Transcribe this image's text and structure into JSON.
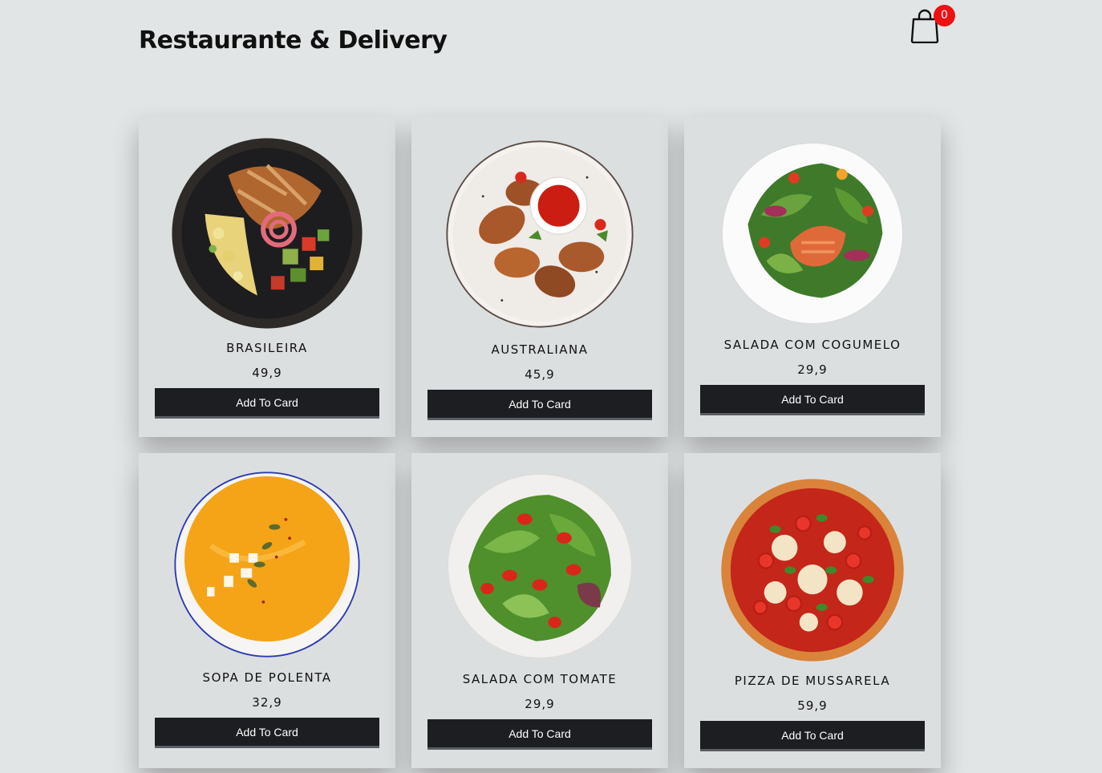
{
  "header": {
    "title": "Restaurante & Delivery"
  },
  "cart": {
    "icon": "shopping-bag-icon",
    "count": "0",
    "badge_color": "#ee1111"
  },
  "products": [
    {
      "name": "BRASILEIRA",
      "price": "49,9",
      "button_label": "Add To Card"
    },
    {
      "name": "AUSTRALIANA",
      "price": "45,9",
      "button_label": "Add To Card"
    },
    {
      "name": "SALADA COM COGUMELO",
      "price": "29,9",
      "button_label": "Add To Card"
    },
    {
      "name": "SOPA DE POLENTA",
      "price": "32,9",
      "button_label": "Add To Card"
    },
    {
      "name": "SALADA COM TOMATE",
      "price": "29,9",
      "button_label": "Add To Card"
    },
    {
      "name": "PIZZA DE MUSSARELA",
      "price": "59,9",
      "button_label": "Add To Card"
    }
  ],
  "colors": {
    "background": "#e2e5e6",
    "card": "#dcdfe0",
    "button": "#1c1e22"
  }
}
